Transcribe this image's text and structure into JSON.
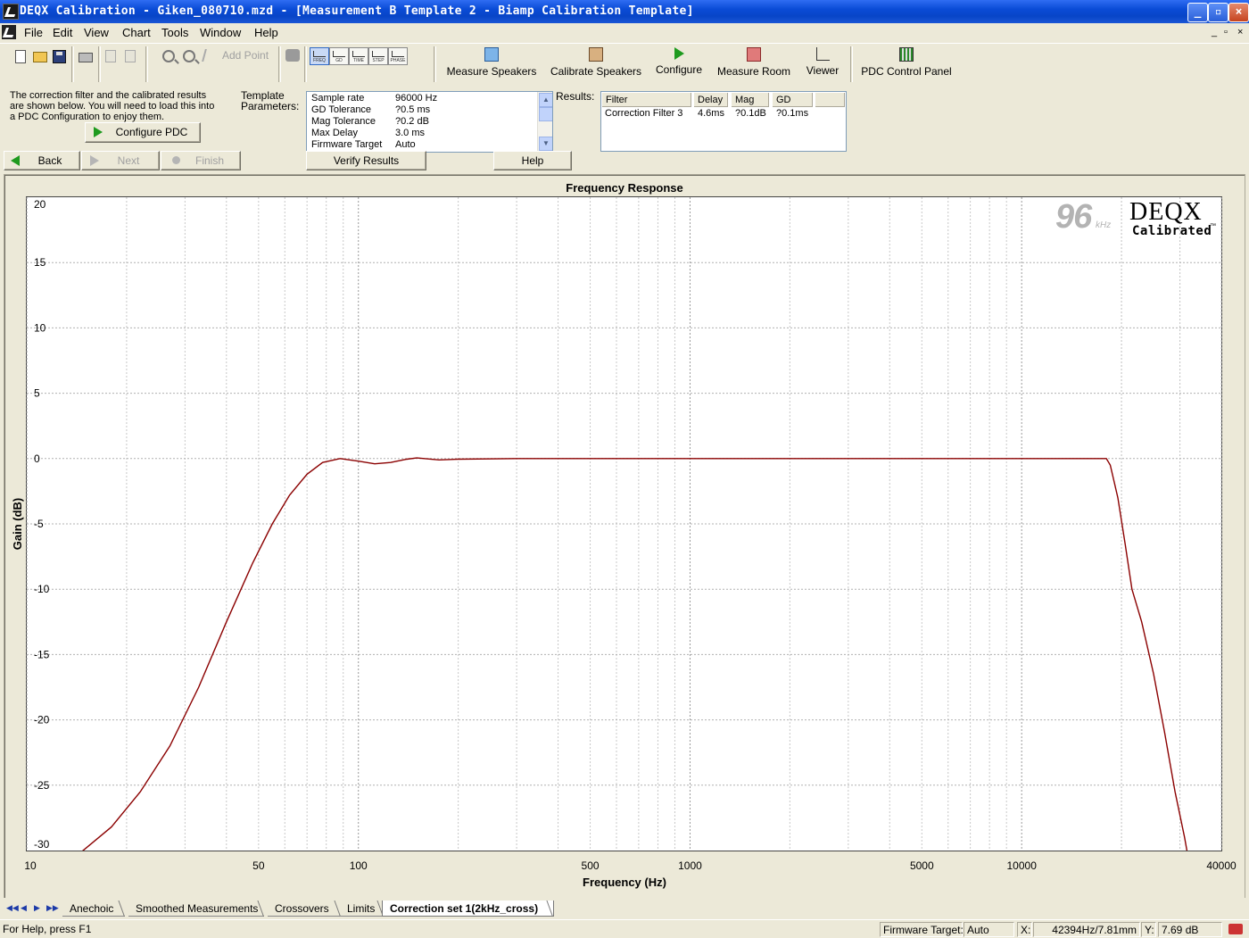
{
  "window": {
    "title": "DEQX Calibration - Giken_080710.mzd - [Measurement B Template 2 - Biamp Calibration Template]",
    "controls": {
      "minimize": "_",
      "restore": "▫",
      "close": "×"
    }
  },
  "menu": {
    "items": [
      "File",
      "Edit",
      "View",
      "Chart",
      "Tools",
      "Window",
      "Help"
    ],
    "mdi_controls": [
      "_",
      "▫",
      "×"
    ]
  },
  "toolbar": {
    "add_point_label": "Add Point",
    "view_buttons": [
      "FREQ",
      "GD",
      "TIME",
      "STEP",
      "PHASE"
    ],
    "big_tools": [
      {
        "label": "Measure Speakers",
        "icon": "measure-speakers-icon"
      },
      {
        "label": "Calibrate Speakers",
        "icon": "calibrate-speakers-icon"
      },
      {
        "label": "Configure",
        "icon": "play-icon"
      },
      {
        "label": "Measure Room",
        "icon": "measure-room-icon"
      },
      {
        "label": "Viewer",
        "icon": "viewer-icon"
      },
      {
        "label": "PDC Control Panel",
        "icon": "pdc-panel-icon"
      }
    ]
  },
  "wizard": {
    "info_text": "The correction filter and the calibrated results are shown below.  You will need to load this into a PDC Configuration to enjoy them.",
    "configure_pdc_label": "Configure PDC",
    "template_label": "Template Parameters:",
    "parameters": [
      {
        "name": "Sample rate",
        "value": "96000 Hz"
      },
      {
        "name": "GD Tolerance",
        "value": "?0.5 ms"
      },
      {
        "name": "Mag Tolerance",
        "value": "?0.2 dB"
      },
      {
        "name": "Max Delay",
        "value": "3.0 ms"
      },
      {
        "name": "Firmware Target",
        "value": "Auto"
      }
    ],
    "results_label": "Results:",
    "results_columns": [
      "Filter",
      "Delay",
      "Mag",
      "GD"
    ],
    "results_rows": [
      [
        "Correction Filter 3",
        "4.6ms",
        "?0.1dB",
        "?0.1ms"
      ]
    ],
    "back_label": "Back",
    "next_label": "Next",
    "finish_label": "Finish",
    "verify_label": "Verify Results",
    "help_label": "Help"
  },
  "chart_data": {
    "type": "line",
    "title": "Frequency Response",
    "xlabel": "Frequency (Hz)",
    "ylabel": "Gain (dB)",
    "x_scale": "log",
    "xlim": [
      10,
      40000
    ],
    "ylim": [
      -30,
      20
    ],
    "x_tick_labels": [
      "10",
      "50",
      "100",
      "500",
      "1000",
      "5000",
      "10000",
      "40000"
    ],
    "x_tick_values": [
      10,
      50,
      100,
      500,
      1000,
      5000,
      10000,
      40000
    ],
    "y_tick_labels": [
      "20",
      "15",
      "10",
      "5",
      "0",
      "-5",
      "-10",
      "-15",
      "-20",
      "-25",
      "-30"
    ],
    "y_tick_values": [
      20,
      15,
      10,
      5,
      0,
      -5,
      -10,
      -15,
      -20,
      -25,
      -30
    ],
    "grid": true,
    "series": [
      {
        "color": "#8b0000",
        "points": [
          [
            14,
            -30.5
          ],
          [
            18,
            -28.2
          ],
          [
            22,
            -25.5
          ],
          [
            27,
            -22.0
          ],
          [
            33,
            -17.5
          ],
          [
            40,
            -12.5
          ],
          [
            48,
            -8.0
          ],
          [
            55,
            -5.0
          ],
          [
            62,
            -2.8
          ],
          [
            70,
            -1.2
          ],
          [
            78,
            -0.3
          ],
          [
            88,
            0.0
          ],
          [
            100,
            -0.2
          ],
          [
            112,
            -0.4
          ],
          [
            125,
            -0.3
          ],
          [
            140,
            -0.05
          ],
          [
            150,
            0.05
          ],
          [
            175,
            -0.1
          ],
          [
            200,
            -0.05
          ],
          [
            300,
            0.0
          ],
          [
            400,
            0.0
          ],
          [
            1000,
            0.0
          ],
          [
            5000,
            0.0
          ],
          [
            10000,
            0.0
          ],
          [
            18000,
            0.0
          ],
          [
            18500,
            -0.5
          ],
          [
            19500,
            -3.0
          ],
          [
            20500,
            -6.5
          ],
          [
            21500,
            -10.0
          ],
          [
            23000,
            -12.5
          ],
          [
            25000,
            -16.5
          ],
          [
            27000,
            -21.0
          ],
          [
            29000,
            -25.5
          ],
          [
            31000,
            -29.0
          ],
          [
            32000,
            -31.0
          ]
        ]
      }
    ],
    "watermark": {
      "rate": "96",
      "unit": "kHz",
      "brand": "DEQX",
      "subtitle": "Calibrated",
      "tm": "™"
    }
  },
  "tabs": {
    "items": [
      "Anechoic",
      "Smoothed Measurements",
      "Crossovers",
      "Limits",
      "Correction set 1(2kHz_cross)"
    ],
    "active_index": 4
  },
  "status": {
    "help_text": "For Help, press F1",
    "firmware_label": "Firmware Target:",
    "firmware_value": "Auto",
    "x_label": "X:",
    "x_value": "42394Hz/7.81mm",
    "y_label": "Y:",
    "y_value": "7.69 dB"
  }
}
